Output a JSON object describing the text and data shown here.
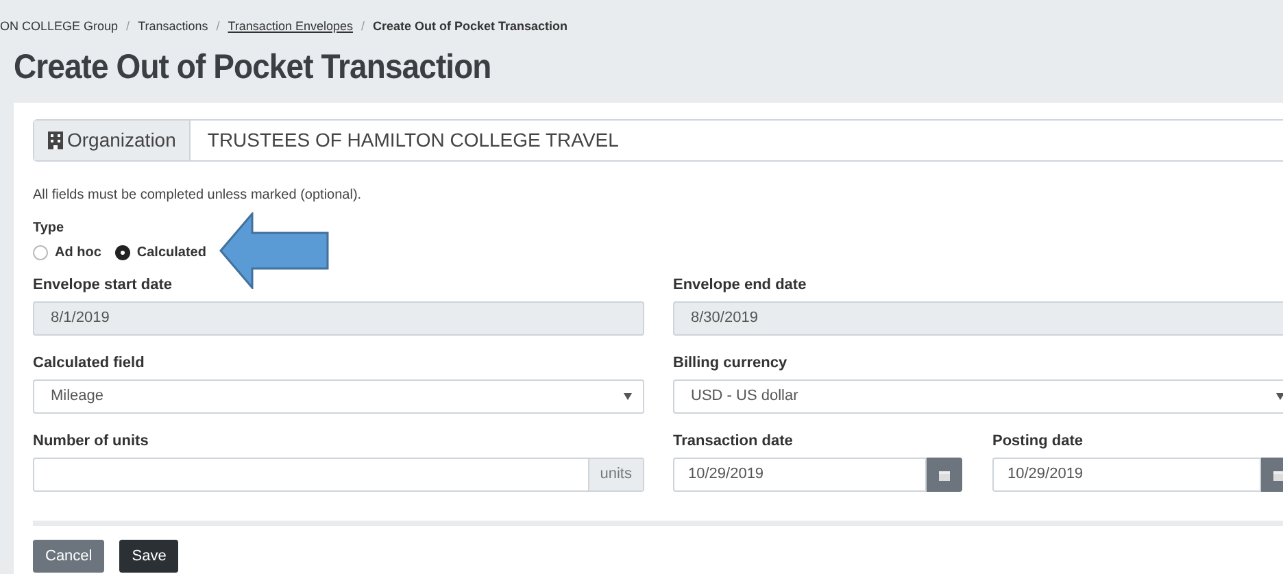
{
  "breadcrumb": [
    {
      "label": "ON COLLEGE Group",
      "kind": "plain"
    },
    {
      "separator": "/",
      "label": "Transactions",
      "kind": "plain"
    },
    {
      "separator": "/",
      "label": "Transaction Envelopes",
      "kind": "link"
    },
    {
      "separator": "/",
      "label": "Create Out of Pocket Transaction",
      "kind": "current"
    }
  ],
  "title": "Create Out of Pocket Transaction",
  "organization": {
    "label": "Organization",
    "value": "TRUSTEES OF HAMILTON COLLEGE TRAVEL"
  },
  "note": "All fields must be completed unless marked (optional).",
  "type": {
    "label": "Type",
    "options": [
      {
        "label": "Ad hoc",
        "selected": false
      },
      {
        "label": "Calculated",
        "selected": true
      }
    ]
  },
  "envelope_start_date": {
    "label": "Envelope start date",
    "value": "8/1/2019"
  },
  "envelope_end_date": {
    "label": "Envelope end date",
    "value": "8/30/2019"
  },
  "calculated_field": {
    "label": "Calculated field",
    "value": "Mileage"
  },
  "billing_currency": {
    "label": "Billing currency",
    "value": "USD - US dollar"
  },
  "number_of_units": {
    "label": "Number of units",
    "addon": "units"
  },
  "transaction_date": {
    "label": "Transaction date",
    "value": "10/29/2019"
  },
  "posting_date": {
    "label": "Posting date",
    "value": "10/29/2019"
  },
  "buttons": [
    {
      "label": "Cancel",
      "kind": "secondary"
    },
    {
      "label": "Save",
      "kind": "primary"
    }
  ]
}
